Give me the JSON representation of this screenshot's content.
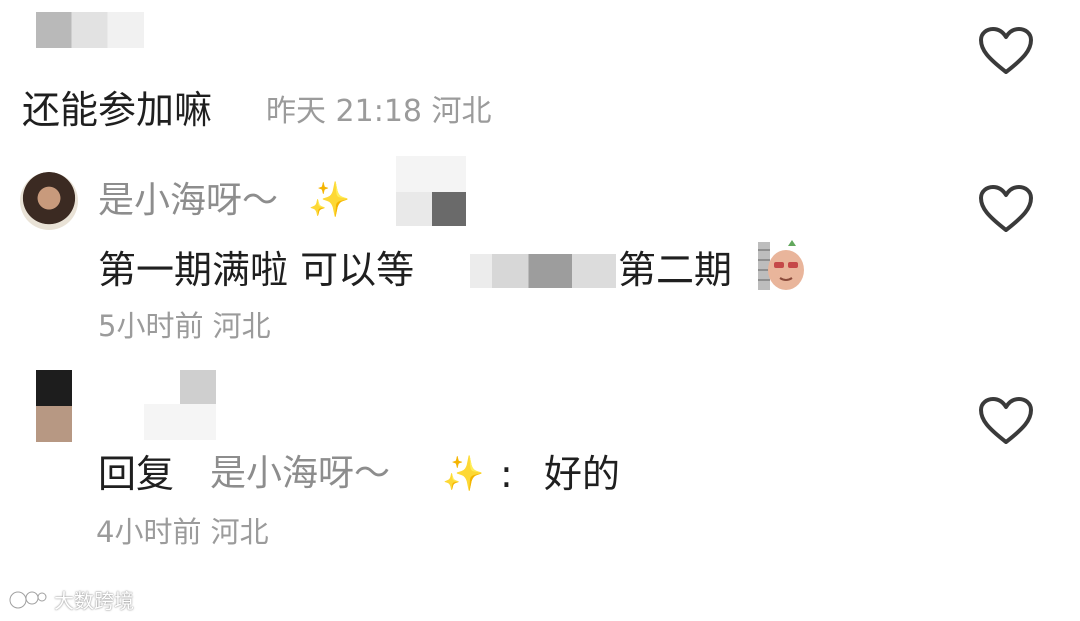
{
  "comment1": {
    "text": "还能参加嘛",
    "meta": "昨天 21:18 河北"
  },
  "comment2": {
    "author": "是小海呀～",
    "author_emoji": "✨",
    "text_part1": "第一期满啦 可以等",
    "text_part2": "第二期",
    "meta": "5小时前  河北"
  },
  "comment3": {
    "reply_label": "回复",
    "reply_to": "是小海呀～",
    "reply_emoji": "✨",
    "colon": ":",
    "text": "好的",
    "meta": "4小时前  河北"
  },
  "watermark": {
    "text": "大数跨境"
  },
  "icons": {
    "like": "heart-outline-icon",
    "watermark_logo": "brand-logo-icon"
  },
  "colors": {
    "text": "#1f1f1f",
    "meta": "#9b9b9b",
    "name": "#8d8d8d"
  }
}
